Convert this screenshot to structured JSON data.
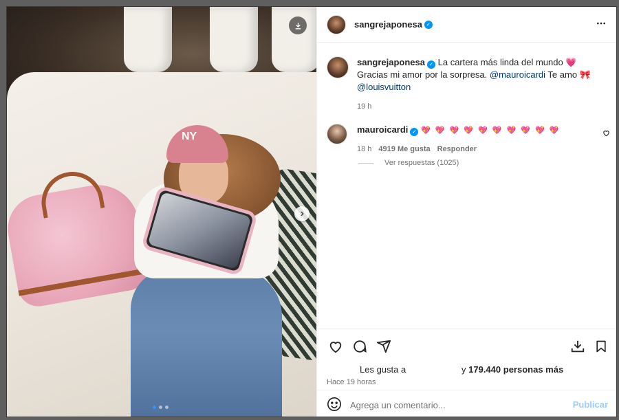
{
  "post": {
    "author": "sangrejaponesa",
    "verified": true
  },
  "caption": {
    "author": "sangrejaponesa",
    "line1_text": "La cartera más linda del mundo",
    "line1_emoji": "💗",
    "line2_text": "Gracias mi amor por la sorpresa.",
    "mention1": "@mauroicardi",
    "line2_after": "Te amo",
    "line2_emoji": "🎀",
    "mention2": "@louisvuitton",
    "time": "19 h"
  },
  "comment": {
    "author": "mauroicardi",
    "hearts": "💖 💖 💖 💖 💖 💖 💖 💖 💖 💖",
    "time": "18 h",
    "likes": "4919 Me gusta",
    "reply": "Responder",
    "view_replies": "Ver respuestas (1025)"
  },
  "likes": {
    "prefix": "Les gusta a",
    "suffix_pre": "y",
    "count": "179.440",
    "suffix_post": "personas más"
  },
  "timestamp": "Hace 19 horas",
  "add_comment": {
    "placeholder": "Agrega un comentario...",
    "publish": "Publicar"
  },
  "carousel": {
    "slides": 3,
    "active": 1
  },
  "icons": {
    "header_more": "more-icon",
    "like": "heart-icon",
    "comment": "comment-icon",
    "share": "share-icon",
    "save_collection": "download-collection-icon",
    "save": "bookmark-icon",
    "emoji": "smiley-icon",
    "download": "download-icon",
    "next": "chevron-right-icon"
  },
  "colors": {
    "link": "#00376b",
    "verified": "#0095f6",
    "publish_disabled": "#9ccdfb"
  }
}
